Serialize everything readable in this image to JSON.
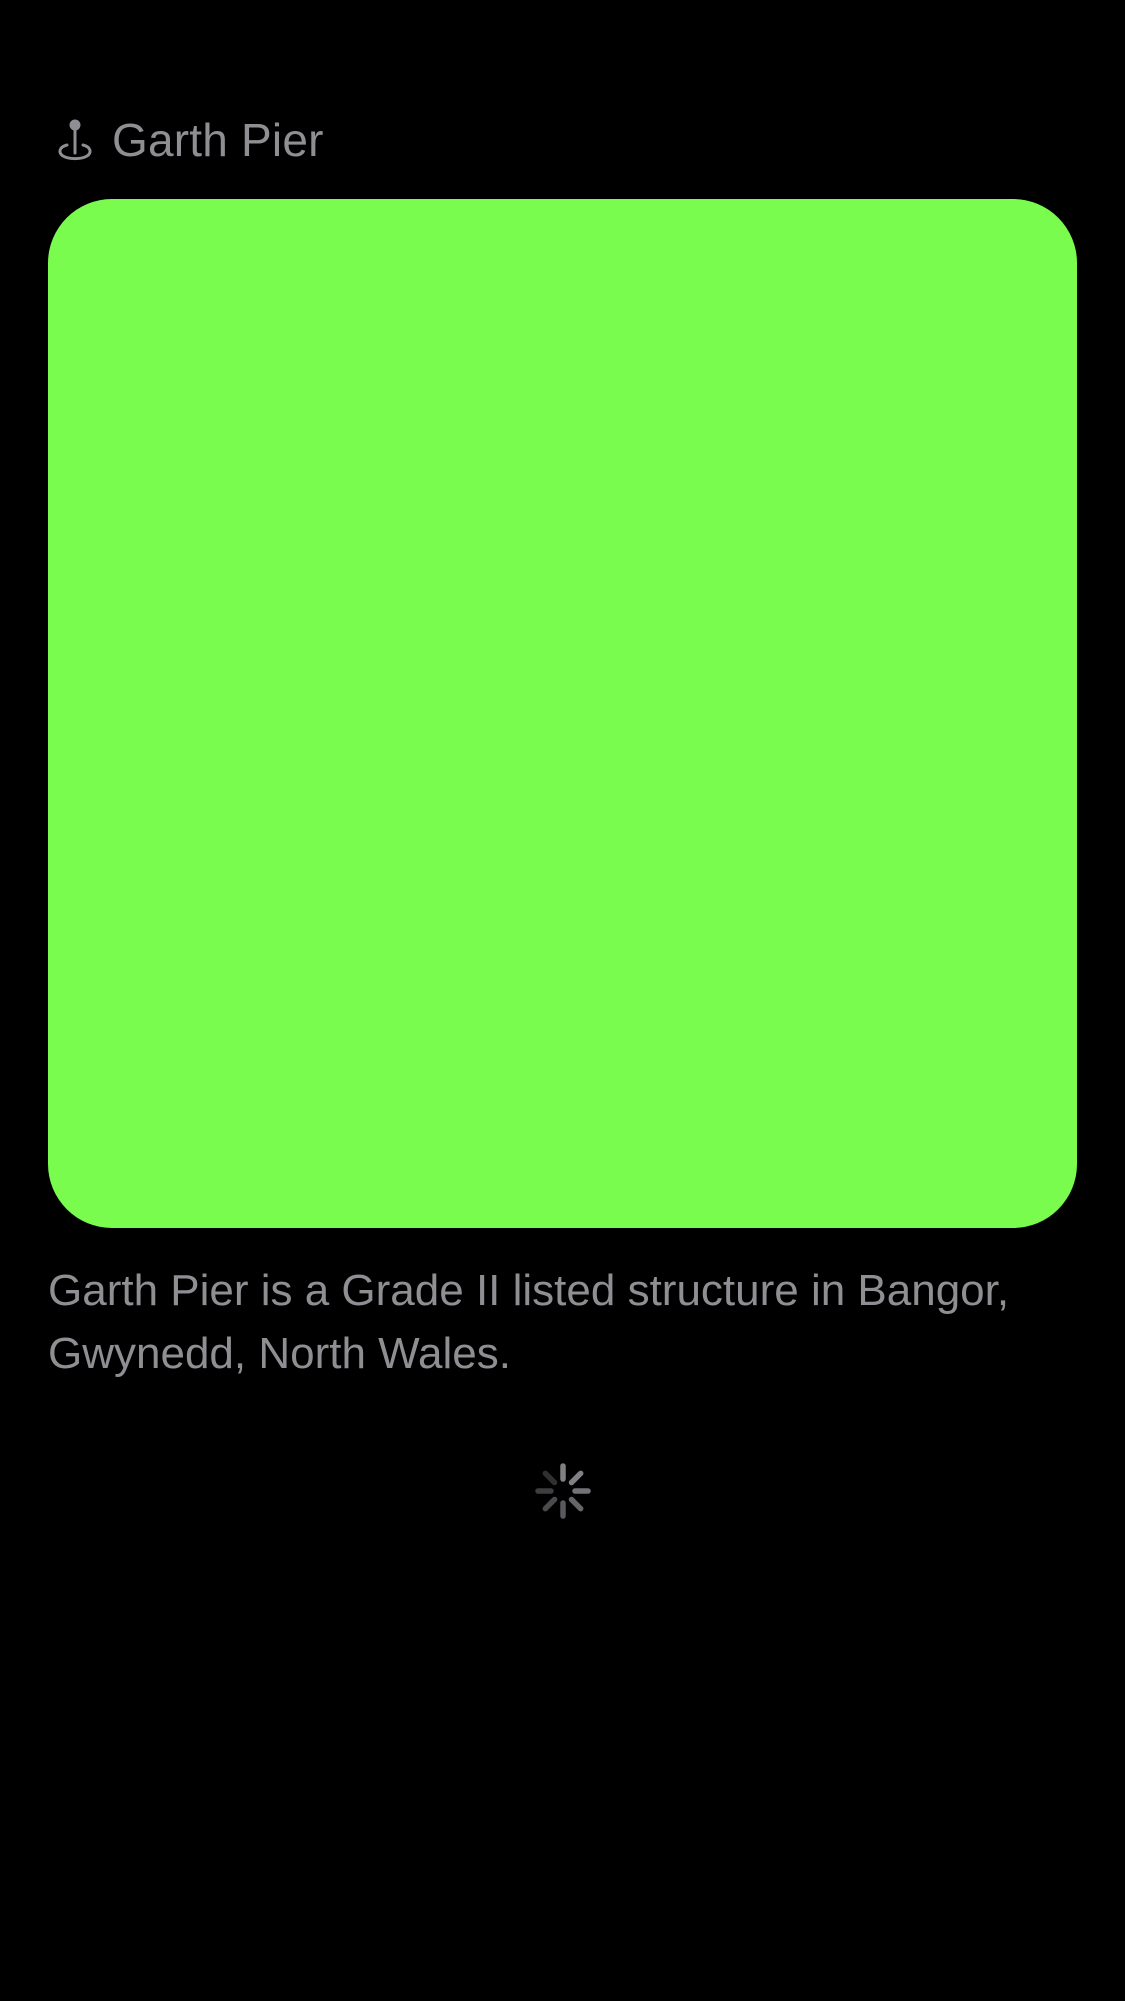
{
  "header": {
    "icon": "landmark-pin-icon",
    "title": "Garth Pier"
  },
  "media": {
    "color": "#79fc4e"
  },
  "description": "Garth Pier is a Grade II listed structure in Bangor, Gwynedd, North Wales.",
  "loading": {
    "icon": "activity-spinner-icon"
  }
}
